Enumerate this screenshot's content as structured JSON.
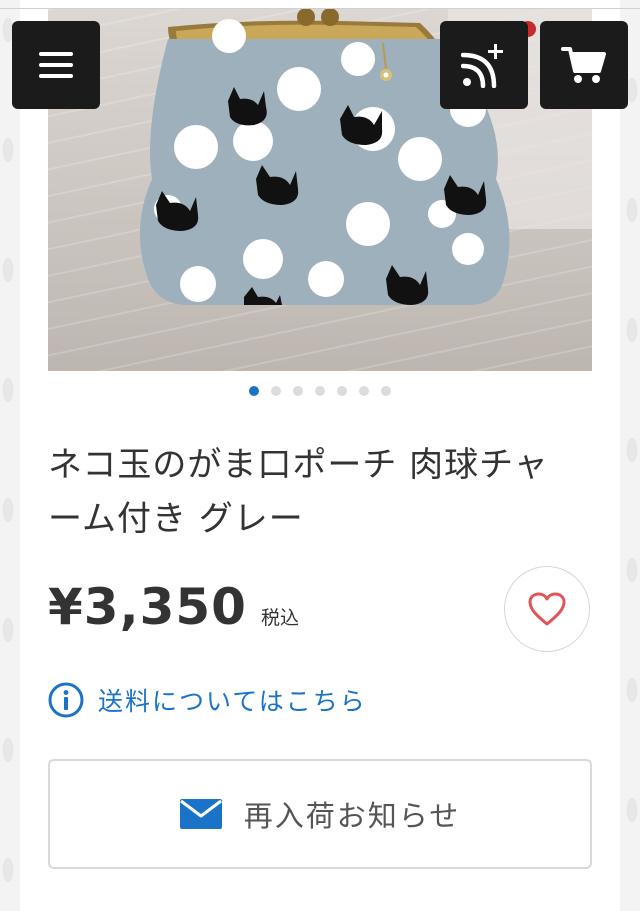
{
  "header": {
    "menu_icon": "hamburger-menu-icon",
    "rss_icon": "rss-follow-icon",
    "cart_icon": "shopping-cart-icon"
  },
  "gallery": {
    "image_count": 7,
    "active_index": 0
  },
  "product": {
    "title": "ネコ玉のがま口ポーチ 肉球チャーム付き グレー",
    "price": "¥3,350",
    "tax_label": "税込",
    "favorite_icon": "heart-icon"
  },
  "shipping": {
    "link_text": "送料についてはこちら",
    "icon": "info-circle-icon"
  },
  "restock": {
    "label": "再入荷お知らせ",
    "icon": "mail-icon"
  },
  "colors": {
    "accent": "#1a73c7",
    "heart": "#e05555",
    "button_dark": "#1b1b1b",
    "text": "#333333"
  }
}
